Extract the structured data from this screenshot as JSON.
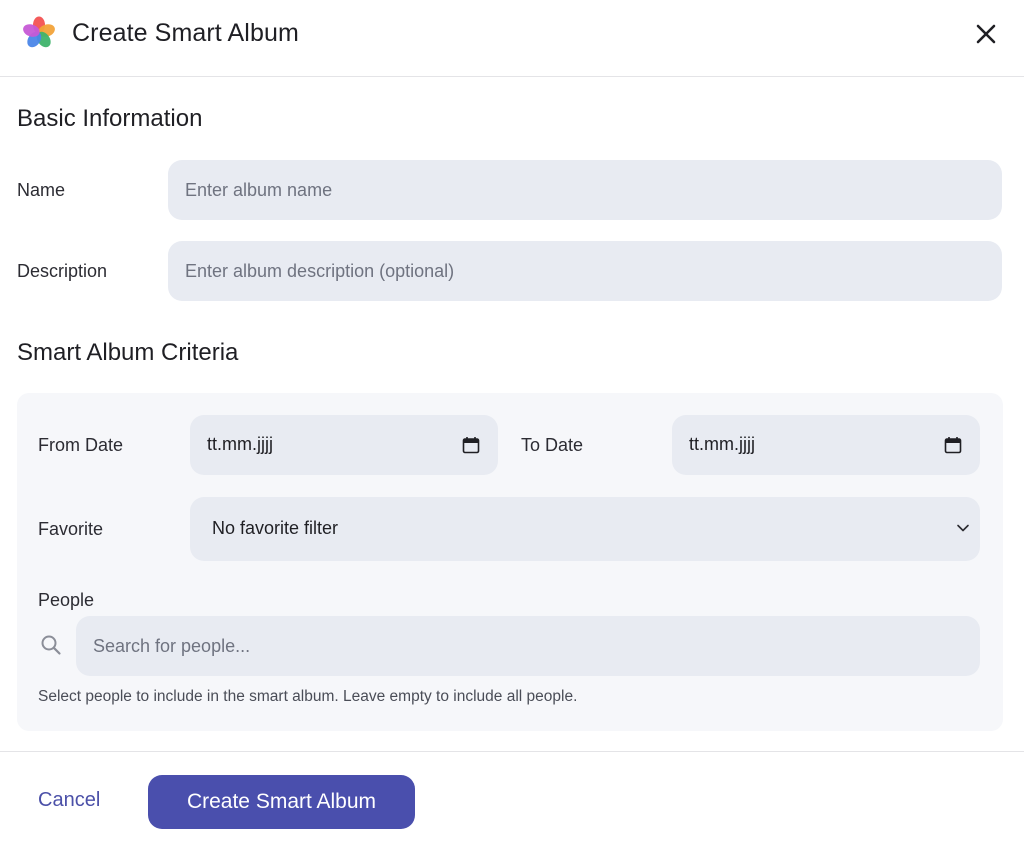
{
  "dialog": {
    "title": "Create Smart Album",
    "logo_icon": "photo-app-logo-icon",
    "close_icon": "close-icon"
  },
  "basic_info": {
    "heading": "Basic Information",
    "name_label": "Name",
    "name_placeholder": "Enter album name",
    "name_value": "",
    "description_label": "Description",
    "description_placeholder": "Enter album description (optional)",
    "description_value": ""
  },
  "criteria": {
    "heading": "Smart Album Criteria",
    "from_date_label": "From Date",
    "from_date_value": "tt.mm.jjjj",
    "to_date_label": "To Date",
    "to_date_value": "tt.mm.jjjj",
    "favorite_label": "Favorite",
    "favorite_selected": "No favorite filter",
    "people_label": "People",
    "people_search_placeholder": "Search for people...",
    "people_hint": "Select people to include in the smart album. Leave empty to include all people."
  },
  "footer": {
    "cancel_label": "Cancel",
    "create_label": "Create Smart Album"
  },
  "colors": {
    "accent": "#4a4fad",
    "input_bg": "#e8ebf2",
    "panel_bg": "#f6f7fa"
  }
}
